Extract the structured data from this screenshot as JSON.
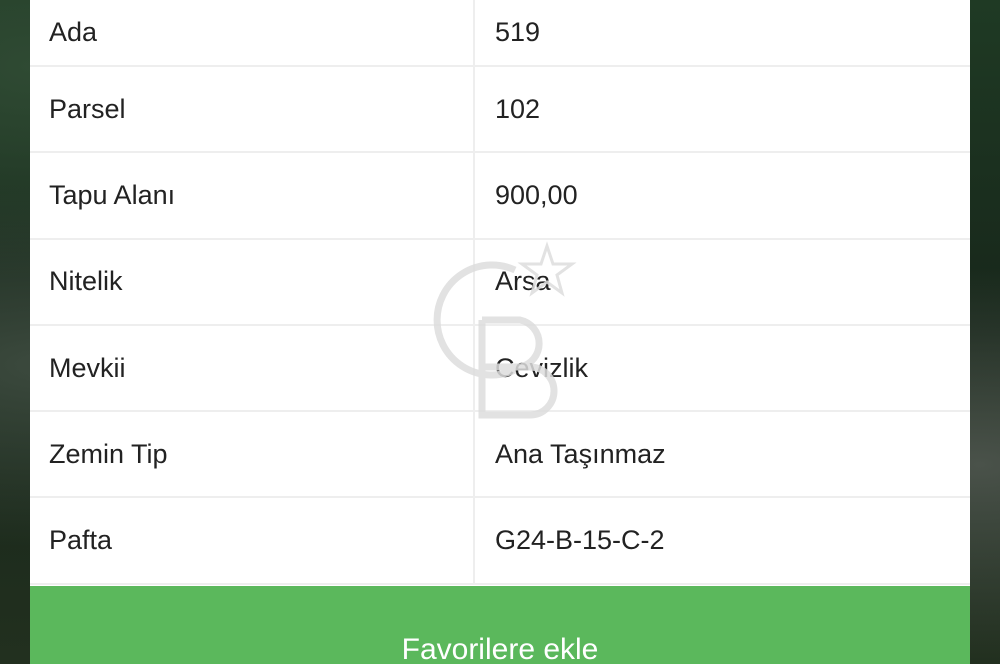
{
  "properties": [
    {
      "label": "Ada",
      "value": "519"
    },
    {
      "label": "Parsel",
      "value": "102"
    },
    {
      "label": "Tapu Alanı",
      "value": "900,00"
    },
    {
      "label": "Nitelik",
      "value": "Arsa"
    },
    {
      "label": "Mevkii",
      "value": "Cevizlik"
    },
    {
      "label": "Zemin Tip",
      "value": "Ana Taşınmaz"
    },
    {
      "label": "Pafta",
      "value": "G24-B-15-C-2"
    }
  ],
  "actions": {
    "favorite_label": "Favorilere ekle"
  },
  "colors": {
    "button": "#5bb85c",
    "panel": "#ffffff",
    "divider": "#eeeeee",
    "text": "#222222"
  },
  "icons": {
    "watermark": "cb-logo-watermark-icon"
  }
}
